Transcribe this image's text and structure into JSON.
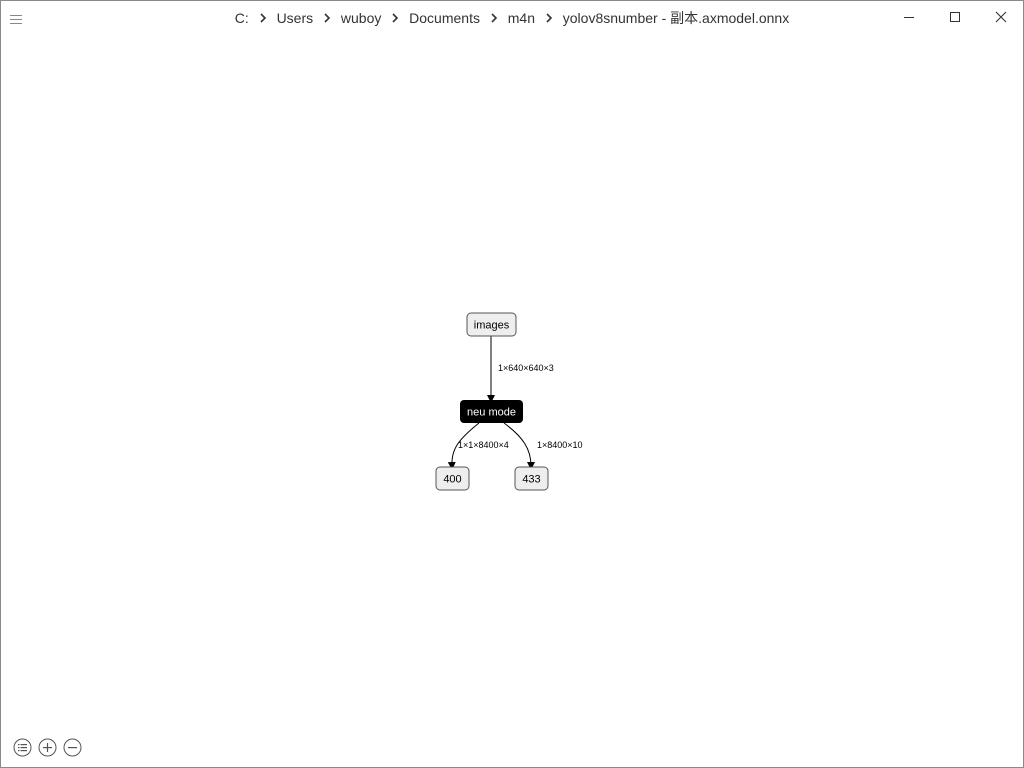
{
  "window": {
    "breadcrumb": [
      "C:",
      "Users",
      "wuboy",
      "Documents",
      "m4n",
      "yolov8snumber - 副本.axmodel.onnx"
    ]
  },
  "graph": {
    "nodes": {
      "input": "images",
      "op": "neu mode",
      "output_a": "400",
      "output_b": "433"
    },
    "edges": {
      "input_to_op": "1×640×640×3",
      "op_to_a": "1×1×8400×4",
      "op_to_b": "1×8400×10"
    }
  },
  "icons": {
    "menu": "hamburger-menu-icon",
    "minimize": "minimize-icon",
    "maximize": "maximize-icon",
    "close": "close-icon",
    "list": "list-icon",
    "zoom_in": "zoom-in-icon",
    "zoom_out": "zoom-out-icon"
  },
  "colors": {
    "op_node_fill": "#000000",
    "io_node_fill": "#eeeeee",
    "text": "#333333"
  }
}
